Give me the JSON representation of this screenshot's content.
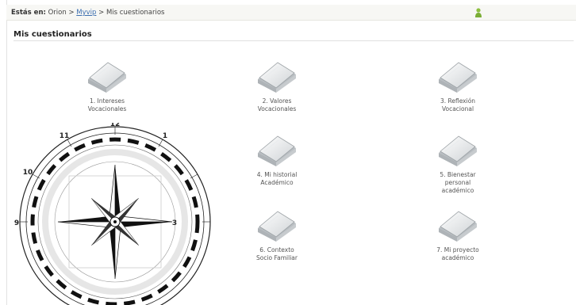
{
  "breadcrumb": {
    "prefix": "Estás en:",
    "root": "Orion",
    "separator": ">",
    "link": "Myvip",
    "current": "Mis cuestionarios"
  },
  "section_title": "Mis cuestionarios",
  "questionnaires": [
    {
      "line1": "1. Intereses",
      "line2": "Vocacionales",
      "line3": "",
      "icon": "folder-icon"
    },
    {
      "line1": "2. Valores",
      "line2": "Vocacionales",
      "line3": "",
      "icon": "folder-icon"
    },
    {
      "line1": "3. Reflexión",
      "line2": "Vocacional",
      "line3": "",
      "icon": "folder-icon"
    },
    {
      "line1": "4. Mi historial",
      "line2": "Académico",
      "line3": "",
      "icon": "folder-icon"
    },
    {
      "line1": "5. Bienestar",
      "line2": "personal",
      "line3": "académico",
      "icon": "folder-icon"
    },
    {
      "line1": "6. Contexto",
      "line2": "Socio Familiar",
      "line3": "",
      "icon": "folder-icon"
    },
    {
      "line1": "7. Mi proyecto",
      "line2": "académico",
      "line3": "",
      "icon": "folder-icon"
    }
  ],
  "compass": {
    "icon": "compass-rose-icon",
    "labels": {
      "n": "12",
      "nnw": "11",
      "wnw": "10",
      "w": "9",
      "nne": "1",
      "e": "3"
    }
  }
}
